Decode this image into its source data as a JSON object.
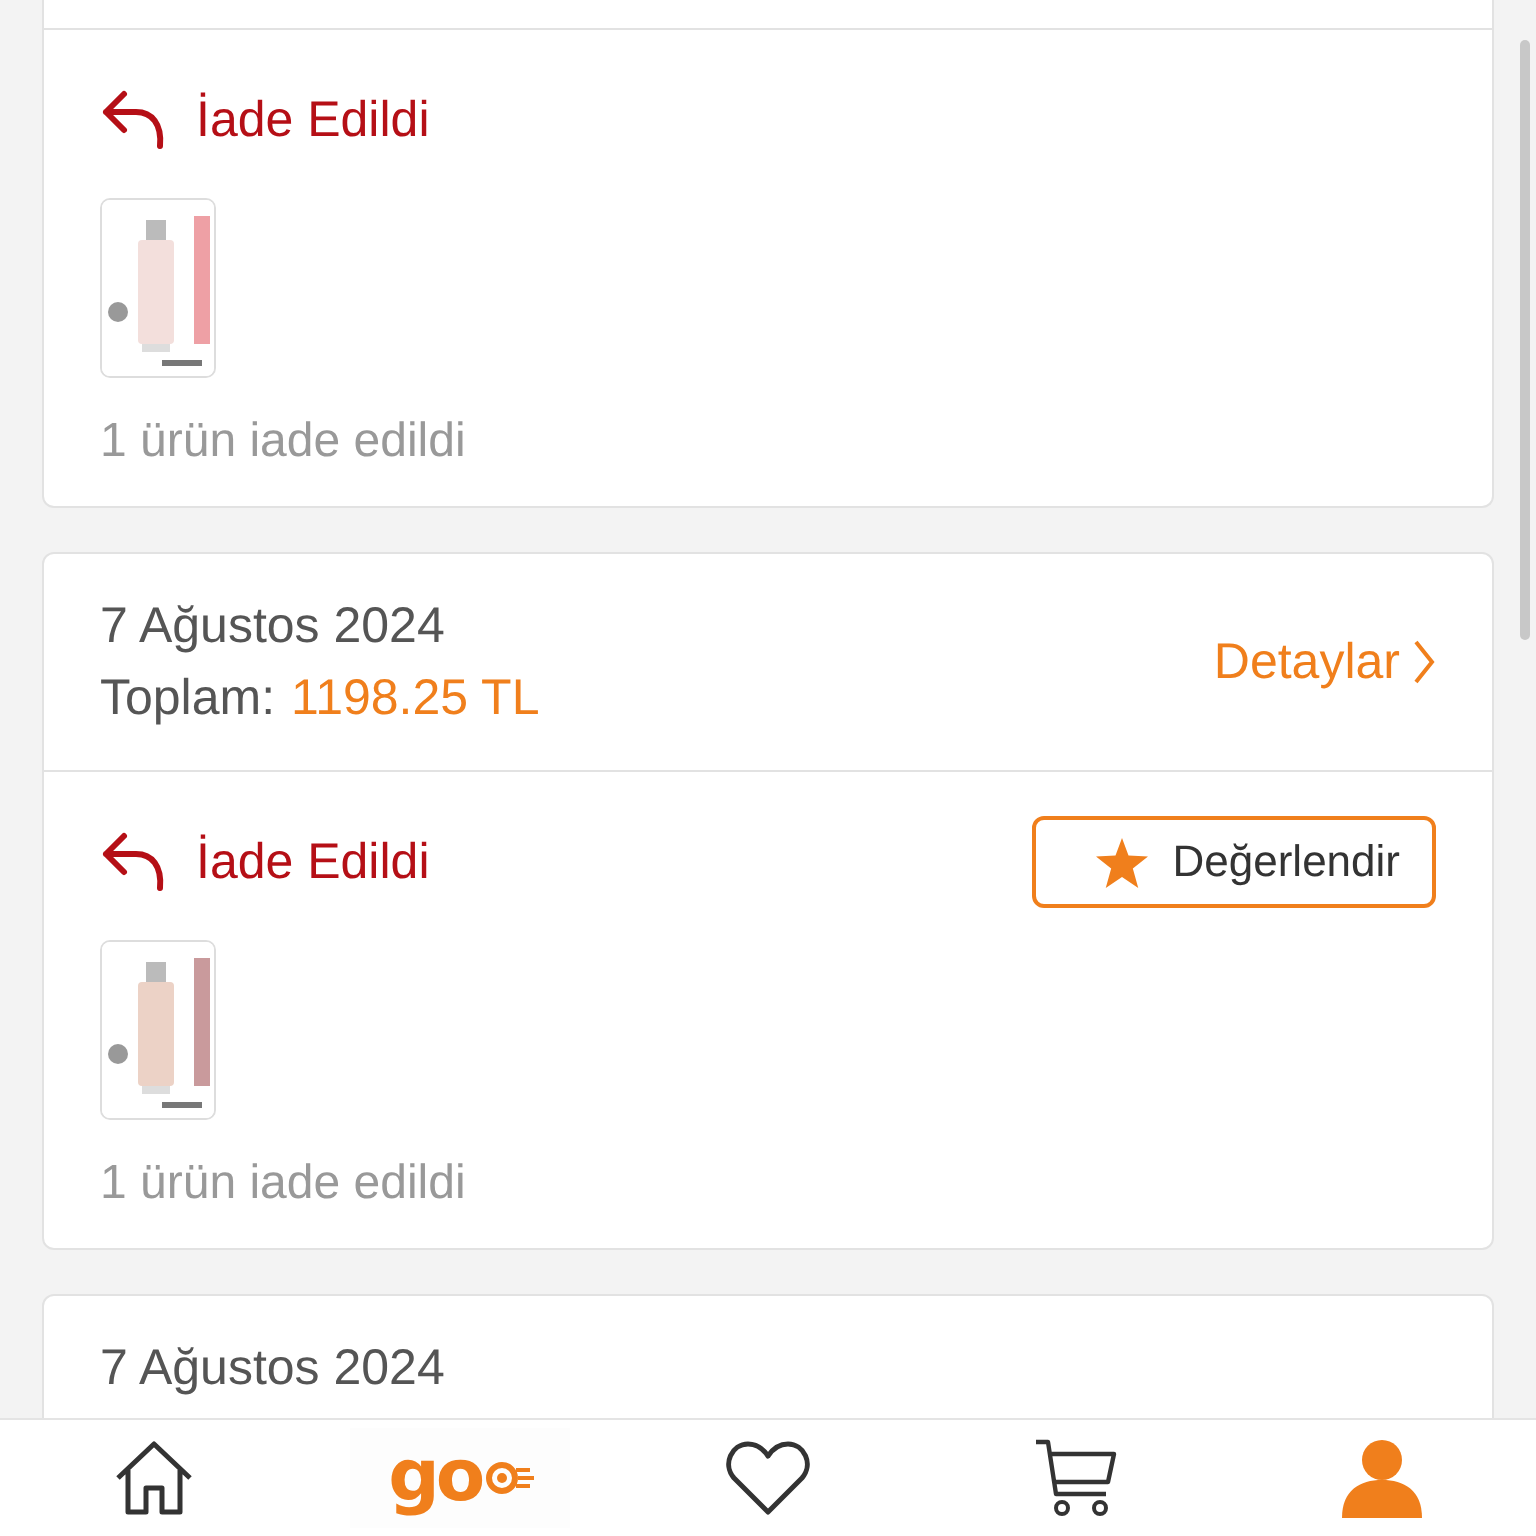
{
  "orders": [
    {
      "shipments": [
        {
          "status": "İade Edildi",
          "summary": "1 ürün iade edildi"
        }
      ]
    },
    {
      "date": "7 Ağustos 2024",
      "total_label": "Toplam:",
      "total": "1198.25 TL",
      "details_link": "Detaylar",
      "shipments": [
        {
          "status": "İade Edildi",
          "rate_button": "Değerlendir",
          "summary": "1 ürün iade edildi"
        }
      ]
    },
    {
      "date": "7 Ağustos 2024"
    }
  ],
  "nav": [
    {
      "kind": "home",
      "selected": false
    },
    {
      "kind": "go",
      "label": "go",
      "selected": false
    },
    {
      "kind": "favorites",
      "selected": false
    },
    {
      "kind": "cart",
      "selected": false
    },
    {
      "kind": "account",
      "selected": true
    }
  ]
}
